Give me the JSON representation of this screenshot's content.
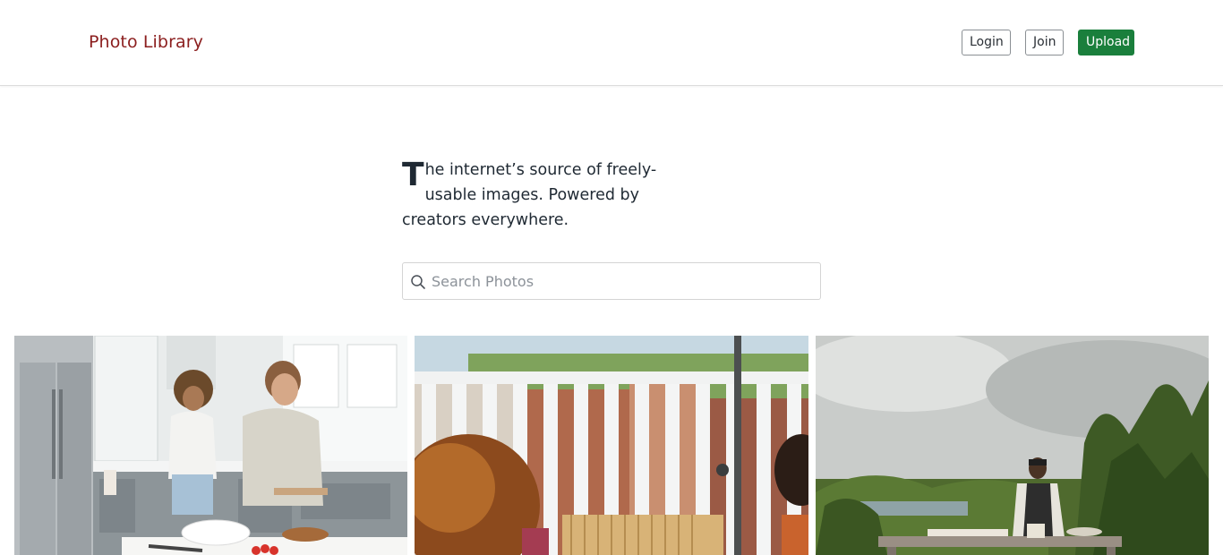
{
  "header": {
    "brand": "Photo Library",
    "login_label": "Login",
    "join_label": "Join",
    "upload_label": "Upload"
  },
  "hero": {
    "dropcap": "T",
    "tagline_rest": "he internet’s source of freely-usable images. Powered by creators everywhere."
  },
  "search": {
    "placeholder": "Search Photos",
    "value": ""
  },
  "colors": {
    "brand": "#8b1e1e",
    "upload_bg": "#1a7f3c"
  }
}
